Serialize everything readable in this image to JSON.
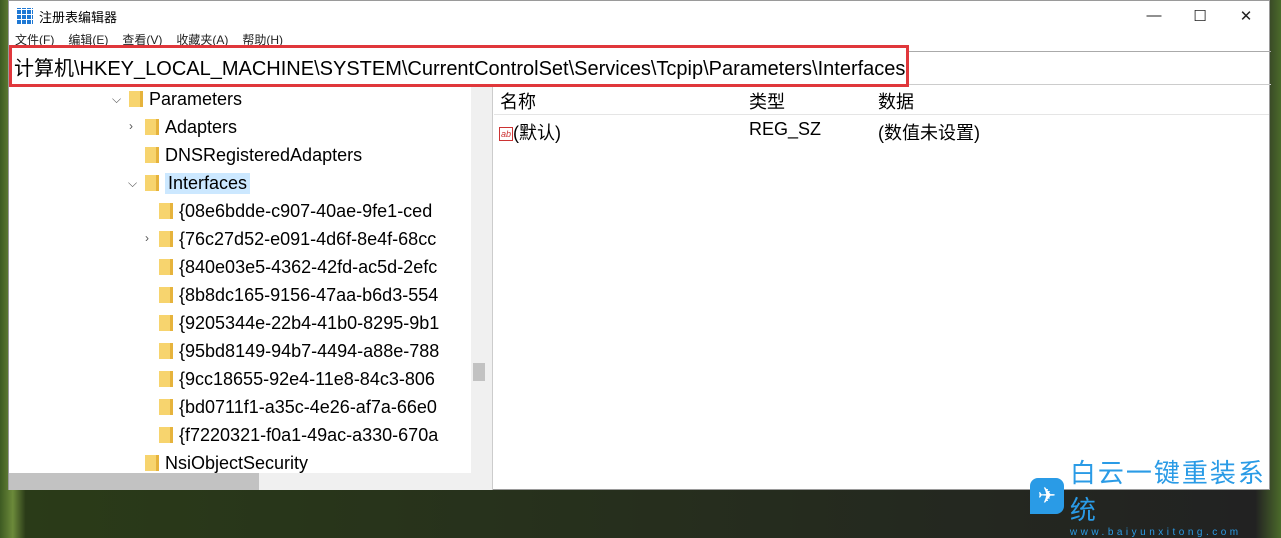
{
  "window": {
    "title": "注册表编辑器",
    "minimize": "—",
    "maximize": "☐",
    "close": "✕"
  },
  "menu": [
    "文件(F)",
    "编辑(E)",
    "查看(V)",
    "收藏夹(A)",
    "帮助(H)"
  ],
  "address": "计算机\\HKEY_LOCAL_MACHINE\\SYSTEM\\CurrentControlSet\\Services\\Tcpip\\Parameters\\Interfaces",
  "tree": {
    "parameters": "Parameters",
    "adapters": "Adapters",
    "dns": "DNSRegisteredAdapters",
    "interfaces": "Interfaces",
    "guids": [
      "{08e6bdde-c907-40ae-9fe1-ced",
      "{76c27d52-e091-4d6f-8e4f-68cc",
      "{840e03e5-4362-42fd-ac5d-2efc",
      "{8b8dc165-9156-47aa-b6d3-554",
      "{9205344e-22b4-41b0-8295-9b1",
      "{95bd8149-94b7-4494-a88e-788",
      "{9cc18655-92e4-11e8-84c3-806",
      "{bd0711f1-a35c-4e26-af7a-66e0",
      "{f7220321-f0a1-49ac-a330-670a"
    ],
    "nsi": "NsiObjectSecurity"
  },
  "list": {
    "headers": {
      "name": "名称",
      "type": "类型",
      "data": "数据"
    },
    "rows": [
      {
        "name": "(默认)",
        "type": "REG_SZ",
        "data": "(数值未设置)"
      }
    ]
  },
  "watermark": {
    "title": "白云一键重装系统",
    "url": "www.baiyunxitong.com"
  }
}
